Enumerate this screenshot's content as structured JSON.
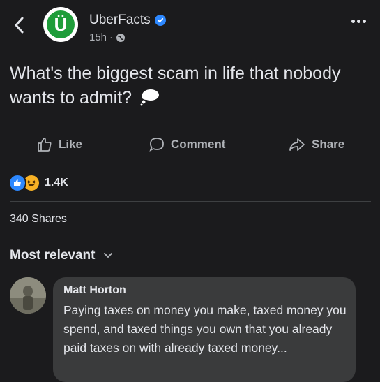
{
  "header": {
    "page_name": "UberFacts",
    "avatar_letter": "Ü",
    "time": "15h",
    "separator": "·"
  },
  "post": {
    "text": "What's the biggest scam in life that nobody wants to admit?"
  },
  "actions": {
    "like": "Like",
    "comment": "Comment",
    "share": "Share"
  },
  "stats": {
    "reaction_count": "1.4K",
    "shares": "340 Shares"
  },
  "comments_filter": {
    "label": "Most relevant"
  },
  "comment": {
    "author": "Matt Horton",
    "text": "Paying taxes on money you make, taxed money you spend, and taxed things you own that you already paid taxes on with already taxed money..."
  },
  "colors": {
    "background": "#1b1b1d",
    "accent_blue": "#2d88ff",
    "avatar_green": "#1f9d3a",
    "comment_bubble": "#3a3b3c",
    "secondary_text": "#b0b3b8"
  }
}
